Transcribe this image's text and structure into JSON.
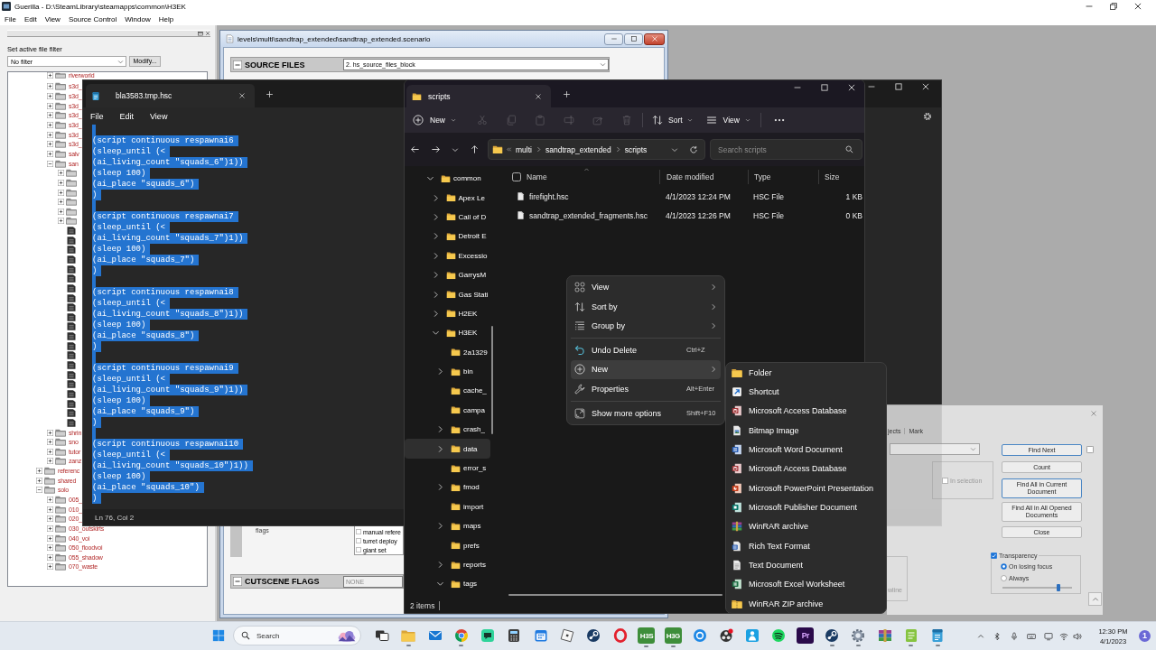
{
  "guerilla": {
    "title": "Guerilla - D:\\SteamLibrary\\steamapps\\common\\H3EK",
    "menu": [
      "File",
      "Edit",
      "View",
      "Source Control",
      "Window",
      "Help"
    ],
    "filter": {
      "label": "Set active file filter",
      "value": "No filter",
      "button": "Modify..."
    },
    "tree": [
      {
        "children": [
          {
            "label": "riverworld",
            "expanded": false
          },
          {
            "label": "s3d_",
            "expanded": false
          },
          {
            "label": "s3d_",
            "expanded": false
          },
          {
            "label": "s3d_",
            "expanded": false
          },
          {
            "label": "s3d_",
            "expanded": false
          },
          {
            "label": "s3d_",
            "expanded": false
          },
          {
            "label": "s3d_",
            "expanded": false
          },
          {
            "label": "s3d_",
            "expanded": false
          },
          {
            "label": "salv",
            "expanded": false
          },
          {
            "label": "san",
            "expanded": true,
            "children": [
              {
                "kind": "folder",
                "expanded": false
              },
              {
                "kind": "folder",
                "expanded": false
              },
              {
                "kind": "folder",
                "expanded": false
              },
              {
                "kind": "folder",
                "expanded": false
              },
              {
                "kind": "folder",
                "expanded": false
              },
              {
                "kind": "folder",
                "expanded": false
              },
              {
                "kind": "file"
              },
              {
                "kind": "file"
              },
              {
                "kind": "file"
              },
              {
                "kind": "file"
              },
              {
                "kind": "file"
              },
              {
                "kind": "file"
              },
              {
                "kind": "file"
              },
              {
                "kind": "file"
              },
              {
                "kind": "file"
              },
              {
                "kind": "file"
              },
              {
                "kind": "file"
              },
              {
                "kind": "file"
              },
              {
                "kind": "file"
              },
              {
                "kind": "file"
              },
              {
                "kind": "file"
              },
              {
                "kind": "file"
              },
              {
                "kind": "file"
              },
              {
                "kind": "file"
              },
              {
                "kind": "file"
              },
              {
                "kind": "file"
              },
              {
                "kind": "file"
              }
            ]
          },
          {
            "label": "shrin",
            "expanded": false
          },
          {
            "label": "sno",
            "expanded": false
          },
          {
            "label": "tutor",
            "expanded": false
          },
          {
            "label": "zanz",
            "expanded": false
          }
        ]
      },
      {
        "label": "referenc",
        "expanded": false
      },
      {
        "label": "shared",
        "expanded": false
      },
      {
        "label": "solo",
        "expanded": true,
        "children": [
          {
            "label": "005_",
            "expanded": false
          },
          {
            "label": "010_",
            "expanded": false
          },
          {
            "label": "020_",
            "expanded": false
          },
          {
            "label": "030_outskirts",
            "expanded": false
          },
          {
            "label": "040_voi",
            "expanded": false
          },
          {
            "label": "050_floodvoi",
            "expanded": false
          },
          {
            "label": "055_shadow",
            "expanded": false
          },
          {
            "label": "070_waste",
            "expanded": false
          }
        ]
      }
    ]
  },
  "scenario": {
    "title": "levels\\multi\\sandtrap_extended\\sandtrap_extended.scenario",
    "source_files": {
      "label": "SOURCE FILES",
      "value": "2. hs_source_files_block"
    },
    "flags": {
      "label": "flags",
      "options": [
        {
          "label": "manual refere",
          "checked": false
        },
        {
          "label": "turret deploy",
          "checked": false
        },
        {
          "label": "giant set",
          "checked": false
        }
      ]
    },
    "cutscene_flags": {
      "label": "CUTSCENE FLAGS",
      "value": "NONE"
    }
  },
  "notepad": {
    "tab": "bla3583.tmp.hsc",
    "menu": [
      "File",
      "Edit",
      "View"
    ],
    "all_selected": true,
    "blocks": [
      [
        "(script continuous respawnai6",
        "(sleep_until (<",
        "(ai_living_count \"squads_6\")1))",
        "(sleep 100)",
        "(ai_place \"squads_6\")",
        ")"
      ],
      [
        "(script continuous respawnai7",
        "(sleep_until (<",
        "(ai_living_count \"squads_7\")1))",
        "(sleep 100)",
        "(ai_place \"squads_7\")",
        ")"
      ],
      [
        "(script continuous respawnai8",
        "(sleep_until (<",
        "(ai_living_count \"squads_8\")1))",
        "(sleep 100)",
        "(ai_place \"squads_8\")",
        ")"
      ],
      [
        "(script continuous respawnai9",
        "(sleep_until (<",
        "(ai_living_count \"squads_9\")1))",
        "(sleep 100)",
        "(ai_place \"squads_9\")",
        ")"
      ],
      [
        "(script continuous respawnai10",
        "(sleep_until (<",
        "(ai_living_count \"squads_10\")1))",
        "(sleep 100)",
        "(ai_place \"squads_10\")",
        ")"
      ]
    ],
    "status": "Ln 76, Col 2"
  },
  "explorer": {
    "tab": "scripts",
    "toolbar": {
      "new": "New",
      "actions": [
        {
          "kind": "cut",
          "disabled": true
        },
        {
          "kind": "copy",
          "disabled": true
        },
        {
          "kind": "paste",
          "disabled": true
        },
        {
          "kind": "rename",
          "disabled": true
        },
        {
          "kind": "share",
          "disabled": true
        },
        {
          "kind": "delete",
          "disabled": true
        }
      ],
      "sort": "Sort",
      "view": "View"
    },
    "address": [
      "multi",
      "sandtrap_extended",
      "scripts"
    ],
    "search": {
      "placeholder": "Search scripts"
    },
    "nav": [
      {
        "label": "common",
        "expandable": true,
        "expanded": true,
        "selected": false,
        "children": [
          {
            "label": "Apex Le",
            "expandable": true,
            "expanded": false,
            "selected": false
          },
          {
            "label": "Call of D",
            "expandable": true,
            "expanded": false,
            "selected": false
          },
          {
            "label": "Detroit E",
            "expandable": true,
            "expanded": false,
            "selected": false
          },
          {
            "label": "Excessio",
            "expandable": true,
            "expanded": false,
            "selected": false
          },
          {
            "label": "GarrysM",
            "expandable": true,
            "expanded": false,
            "selected": false
          },
          {
            "label": "Gas Stati",
            "expandable": true,
            "expanded": false,
            "selected": false
          },
          {
            "label": "H2EK",
            "expandable": true,
            "expanded": false,
            "selected": false
          },
          {
            "label": "H3EK",
            "expandable": true,
            "expanded": true,
            "selected": false,
            "children": [
              {
                "label": "2a1329",
                "expandable": false,
                "selected": false
              },
              {
                "label": "bin",
                "expandable": true,
                "expanded": false,
                "selected": false
              },
              {
                "label": "cache_",
                "expandable": false,
                "selected": false
              },
              {
                "label": "campa",
                "expandable": false,
                "selected": false
              },
              {
                "label": "crash_",
                "expandable": true,
                "expanded": false,
                "selected": false
              },
              {
                "label": "data",
                "expandable": true,
                "expanded": false,
                "selected": true
              },
              {
                "label": "error_s",
                "expandable": false,
                "selected": false
              },
              {
                "label": "fmod",
                "expandable": true,
                "expanded": false,
                "selected": false
              },
              {
                "label": "import",
                "expandable": false,
                "selected": false
              },
              {
                "label": "maps",
                "expandable": true,
                "expanded": false,
                "selected": false
              },
              {
                "label": "prefs",
                "expandable": false,
                "selected": false
              },
              {
                "label": "reports",
                "expandable": true,
                "expanded": false,
                "selected": false
              },
              {
                "label": "tags",
                "expandable": true,
                "expanded": true,
                "selected": false
              }
            ]
          }
        ]
      }
    ],
    "header_checkbox": {
      "checked": false
    },
    "columns": [
      "Name",
      "Date modified",
      "Type",
      "Size"
    ],
    "files": [
      {
        "name": "firefight.hsc",
        "date": "4/1/2023 12:24 PM",
        "type": "HSC File",
        "size": "1 KB"
      },
      {
        "name": "sandtrap_extended_fragments.hsc",
        "date": "4/1/2023 12:26 PM",
        "type": "HSC File",
        "size": "0 KB"
      }
    ],
    "status": "2 items"
  },
  "context_menu": {
    "items": [
      {
        "kind": "view",
        "label": "View",
        "submenu": true,
        "selected": false
      },
      {
        "kind": "sort",
        "label": "Sort by",
        "submenu": true,
        "selected": false
      },
      {
        "kind": "group",
        "label": "Group by",
        "submenu": true,
        "selected": false
      },
      {
        "kind": "separator"
      },
      {
        "kind": "undo",
        "label": "Undo Delete",
        "shortcut": "Ctrl+Z",
        "submenu": false,
        "selected": false
      },
      {
        "kind": "new",
        "label": "New",
        "submenu": true,
        "selected": true
      },
      {
        "kind": "properties",
        "label": "Properties",
        "shortcut": "Alt+Enter",
        "submenu": false,
        "selected": false
      },
      {
        "kind": "separator"
      },
      {
        "kind": "more",
        "label": "Show more options",
        "shortcut": "Shift+F10",
        "submenu": false,
        "selected": false
      }
    ]
  },
  "new_submenu": {
    "items": [
      {
        "kind": "folder",
        "label": "Folder"
      },
      {
        "kind": "shortcut",
        "label": "Shortcut"
      },
      {
        "kind": "database",
        "label": "Microsoft Access Database"
      },
      {
        "kind": "image",
        "label": "Bitmap Image"
      },
      {
        "kind": "document",
        "label": "Microsoft Word Document"
      },
      {
        "kind": "database",
        "label": "Microsoft Access Database"
      },
      {
        "kind": "presentation",
        "label": "Microsoft PowerPoint Presentation"
      },
      {
        "kind": "publication",
        "label": "Microsoft Publisher Document"
      },
      {
        "kind": "archive",
        "label": "WinRAR archive"
      },
      {
        "kind": "richtext",
        "label": "Rich Text Format"
      },
      {
        "kind": "text",
        "label": "Text Document"
      },
      {
        "kind": "spreadsheet",
        "label": "Microsoft Excel Worksheet"
      },
      {
        "kind": "zip",
        "label": "WinRAR ZIP archive"
      }
    ]
  },
  "find_dialog": {
    "tabs": [
      {
        "label": "jects",
        "selected": false
      },
      {
        "label": "Mark",
        "selected": false
      }
    ],
    "buttons": [
      {
        "label": "Find Next",
        "highlighted": true
      },
      {
        "label": "Count",
        "highlighted": false
      },
      {
        "label": "Find All in Current Document",
        "highlighted": true
      },
      {
        "label": "Find All in All Opened Documents",
        "highlighted": false
      },
      {
        "label": "Close",
        "highlighted": false
      }
    ],
    "side_checkbox": {
      "checked": false
    },
    "in_selection": {
      "label": "In selection",
      "checked": false,
      "disabled": true
    },
    "cut_label": "wline",
    "transparency": {
      "label": "Transparency",
      "checked": true,
      "modes": [
        {
          "label": "On losing focus",
          "selected": true
        },
        {
          "label": "Always",
          "selected": false
        }
      ],
      "level": 0.8
    }
  },
  "taskbar": {
    "search": "Search",
    "apps": [
      {
        "kind": "taskview",
        "running": false
      },
      {
        "kind": "files",
        "running": true
      },
      {
        "kind": "mail",
        "running": false
      },
      {
        "kind": "browser",
        "running": true
      },
      {
        "kind": "chat",
        "running": false
      },
      {
        "kind": "calculator",
        "running": false
      },
      {
        "kind": "calendar",
        "running": false
      },
      {
        "kind": "cube",
        "running": false
      },
      {
        "kind": "steam",
        "running": false
      },
      {
        "kind": "ring",
        "running": false
      },
      {
        "kind": "tile",
        "label": "H3S",
        "running": true
      },
      {
        "kind": "tile",
        "label": "H3G",
        "running": true
      },
      {
        "kind": "lens",
        "running": false
      },
      {
        "kind": "circles",
        "running": false
      },
      {
        "kind": "person",
        "running": false
      },
      {
        "kind": "music",
        "running": false
      },
      {
        "kind": "video",
        "label": "Pr",
        "running": false
      },
      {
        "kind": "steam",
        "running": true
      },
      {
        "kind": "settings",
        "running": true
      },
      {
        "kind": "archive",
        "running": false
      },
      {
        "kind": "notes",
        "running": true
      },
      {
        "kind": "notepad",
        "running": true
      }
    ],
    "time": "12:30 PM",
    "date": "4/1/2023",
    "notifications": "1"
  }
}
